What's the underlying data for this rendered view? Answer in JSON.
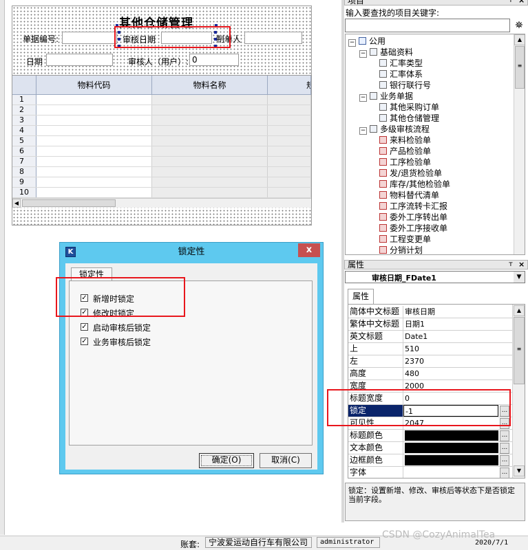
{
  "designer": {
    "title": "其他仓储管理",
    "labels": {
      "doc_no": "单据编号:",
      "audit_date": "审核日期",
      "maker": "制单人",
      "date": "日期",
      "auditor": "审核人（用户）:"
    },
    "auditor_value": "0",
    "grid": {
      "headers": [
        "物料代码",
        "物料名称",
        "规"
      ],
      "rows": [
        "1",
        "2",
        "3",
        "4",
        "5",
        "6",
        "7",
        "8",
        "9",
        "10"
      ]
    }
  },
  "dialog": {
    "title": "锁定性",
    "close": "x",
    "tab": "锁定性",
    "options": [
      {
        "label": "新增时锁定",
        "checked": true
      },
      {
        "label": "修改时锁定",
        "checked": true
      },
      {
        "label": "启动审核后锁定",
        "checked": true
      },
      {
        "label": "业务审核后锁定",
        "checked": true
      }
    ],
    "ok": "确定(O)",
    "cancel": "取消(C)"
  },
  "project_panel": {
    "title": "项目",
    "search_label": "输入要查找的项目关键字:",
    "search_value": "",
    "tree": [
      {
        "level": 0,
        "label": "公用"
      },
      {
        "level": 1,
        "label": "基础资料"
      },
      {
        "level": 2,
        "label": "汇率类型"
      },
      {
        "level": 2,
        "label": "汇率体系"
      },
      {
        "level": 2,
        "label": "银行联行号"
      },
      {
        "level": 1,
        "label": "业务单据"
      },
      {
        "level": 2,
        "label": "其他采购订单"
      },
      {
        "level": 2,
        "label": "其他仓储管理"
      },
      {
        "level": 1,
        "label": "多级审核流程"
      },
      {
        "level": 2,
        "label": "来料检验单"
      },
      {
        "level": 2,
        "label": "产品检验单"
      },
      {
        "level": 2,
        "label": "工序检验单"
      },
      {
        "level": 2,
        "label": "发/退货检验单"
      },
      {
        "level": 2,
        "label": "库存/其他检验单"
      },
      {
        "level": 2,
        "label": "物料替代清单"
      },
      {
        "level": 2,
        "label": "工序流转卡汇报"
      },
      {
        "level": 2,
        "label": "委外工序转出单"
      },
      {
        "level": 2,
        "label": "委外工序接收单"
      },
      {
        "level": 2,
        "label": "工程变更单"
      },
      {
        "level": 2,
        "label": "分销计划"
      }
    ]
  },
  "property_panel": {
    "title": "属性",
    "selected": "审核日期_FDate1",
    "tab": "属性",
    "rows": [
      {
        "key": "简体中文标题",
        "value": "审核日期"
      },
      {
        "key": "繁体中文标题",
        "value": "日期1"
      },
      {
        "key": "英文标题",
        "value": "Date1"
      },
      {
        "key": "上",
        "value": "510"
      },
      {
        "key": "左",
        "value": "2370"
      },
      {
        "key": "高度",
        "value": "480"
      },
      {
        "key": "宽度",
        "value": "2000"
      },
      {
        "key": "标题宽度",
        "value": "0"
      },
      {
        "key": "锁定",
        "value": "-1"
      },
      {
        "key": "可见性",
        "value": "2047"
      },
      {
        "key": "标题颜色",
        "value": ""
      },
      {
        "key": "文本颜色",
        "value": ""
      },
      {
        "key": "边框颜色",
        "value": ""
      },
      {
        "key": "字体",
        "value": ""
      }
    ],
    "description": "锁定：设置新增、修改、审核后等状态下是否锁定当前字段。"
  },
  "status_bar": {
    "account_label": "账套:",
    "company": "宁波爱运动自行车有限公司",
    "user": "administrator",
    "watermark": "CSDN @CozyAnimalTea",
    "date": "2020/7/1"
  },
  "colors": {
    "dialog_frame": "#5ec9ef",
    "highlight_box": "#e8161c",
    "selected_row": "#0a246a"
  }
}
